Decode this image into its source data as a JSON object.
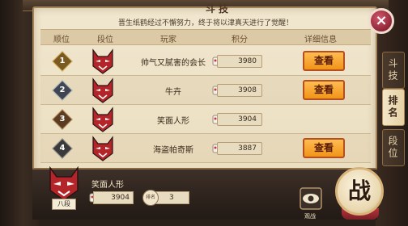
{
  "title": "斗技",
  "notice": "晋生纸鹤经过不懈努力，终于将以津真天进行了觉醒！",
  "table": {
    "headers": [
      "顺位",
      "段位",
      "玩家",
      "积分",
      "详细信息"
    ],
    "rows": [
      {
        "rank": "1",
        "rank_color": "#7a5a20",
        "player": "帅气又腻害的会长",
        "score": "3980",
        "view": "查看"
      },
      {
        "rank": "2",
        "rank_color": "#3f4652",
        "player": "牛卉",
        "score": "3908",
        "view": "查看"
      },
      {
        "rank": "3",
        "rank_color": "#5b3b22",
        "player": "笑面人形",
        "score": "3904",
        "view": ""
      },
      {
        "rank": "4",
        "rank_color": "#3a3a3a",
        "player": "海盗帕奇斯",
        "score": "3887",
        "view": "查看"
      }
    ]
  },
  "self": {
    "tier_label": "八段",
    "name": "笑面人形",
    "score": "3904",
    "rank_badge": "排名",
    "rank": "3"
  },
  "record_label": "观战",
  "battle_label": "战",
  "close_label": "×",
  "side_tabs": [
    {
      "label": "斗技",
      "active": false
    },
    {
      "label": "排名",
      "active": true
    },
    {
      "label": "段位",
      "active": false
    }
  ],
  "colors": {
    "accent_orange": "#f19419",
    "close_red": "#8e2637",
    "panel_paper": "#f1e7cf"
  }
}
